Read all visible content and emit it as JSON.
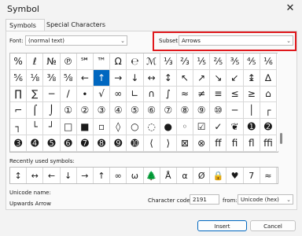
{
  "window": {
    "title": "Symbol",
    "close_glyph": "✕"
  },
  "tabs": {
    "symbols": "Symbols",
    "special": "Special Characters"
  },
  "font": {
    "label": "Font:",
    "value": "(normal text)"
  },
  "subset": {
    "label": "Subset:",
    "value": "Arrows"
  },
  "grid": [
    "%",
    "ℓ",
    "№",
    "℗",
    "℠",
    "™",
    "Ω",
    "℮",
    "ℳ",
    "⅓",
    "⅔",
    "⅕",
    "⅖",
    "⅗",
    "⅘",
    "⅙",
    "⅚",
    "⅛",
    "⅜",
    "⅝",
    "←",
    "↑",
    "→",
    "↓",
    "↔",
    "↕",
    "↖",
    "↗",
    "↘",
    "↙",
    "↨",
    "∆",
    "∏",
    "∑",
    "−",
    "∕",
    "∙",
    "√",
    "∞",
    "∟",
    "∩",
    "∫",
    "≈",
    "≠",
    "≡",
    "≤",
    "≥",
    "⌂",
    "⌐",
    "⌠",
    "⌡",
    "①",
    "②",
    "③",
    "④",
    "⑤",
    "⑥",
    "⑦",
    "⑧",
    "⑨",
    "⑩",
    "─",
    "│",
    "┌",
    "┐",
    "└",
    "┘",
    "□",
    "■",
    "▫",
    "◊",
    "○",
    "◌",
    "●",
    "◦",
    "☑",
    "✓",
    "❦",
    "➊",
    "➋",
    "➌",
    "➍",
    "➎",
    "➏",
    "➐",
    "➑",
    "➒",
    "➓",
    "⟨",
    "⟩",
    "⊠",
    "⊗",
    "ﬀ",
    "ﬁ",
    "ﬂ",
    "ﬃ"
  ],
  "selected_index": 21,
  "recent": {
    "label": "Recently used symbols:",
    "symbols": [
      "↕",
      "↔",
      "←",
      "↓",
      "→",
      "↑",
      "∞",
      "ω",
      "🌲",
      "Å",
      "α",
      "Ø",
      "🔒",
      "♥",
      "7",
      "≈"
    ]
  },
  "unicode": {
    "name_label": "Unicode name:",
    "name_value": "Upwards Arrow"
  },
  "charcode": {
    "label": "Character code:",
    "value": "2191",
    "from_label": "from:",
    "from_value": "Unicode (hex)"
  },
  "buttons": {
    "insert": "Insert",
    "cancel": "Cancel"
  },
  "colors": {
    "selected": "#0067c0",
    "highlight": "#e0181c"
  }
}
